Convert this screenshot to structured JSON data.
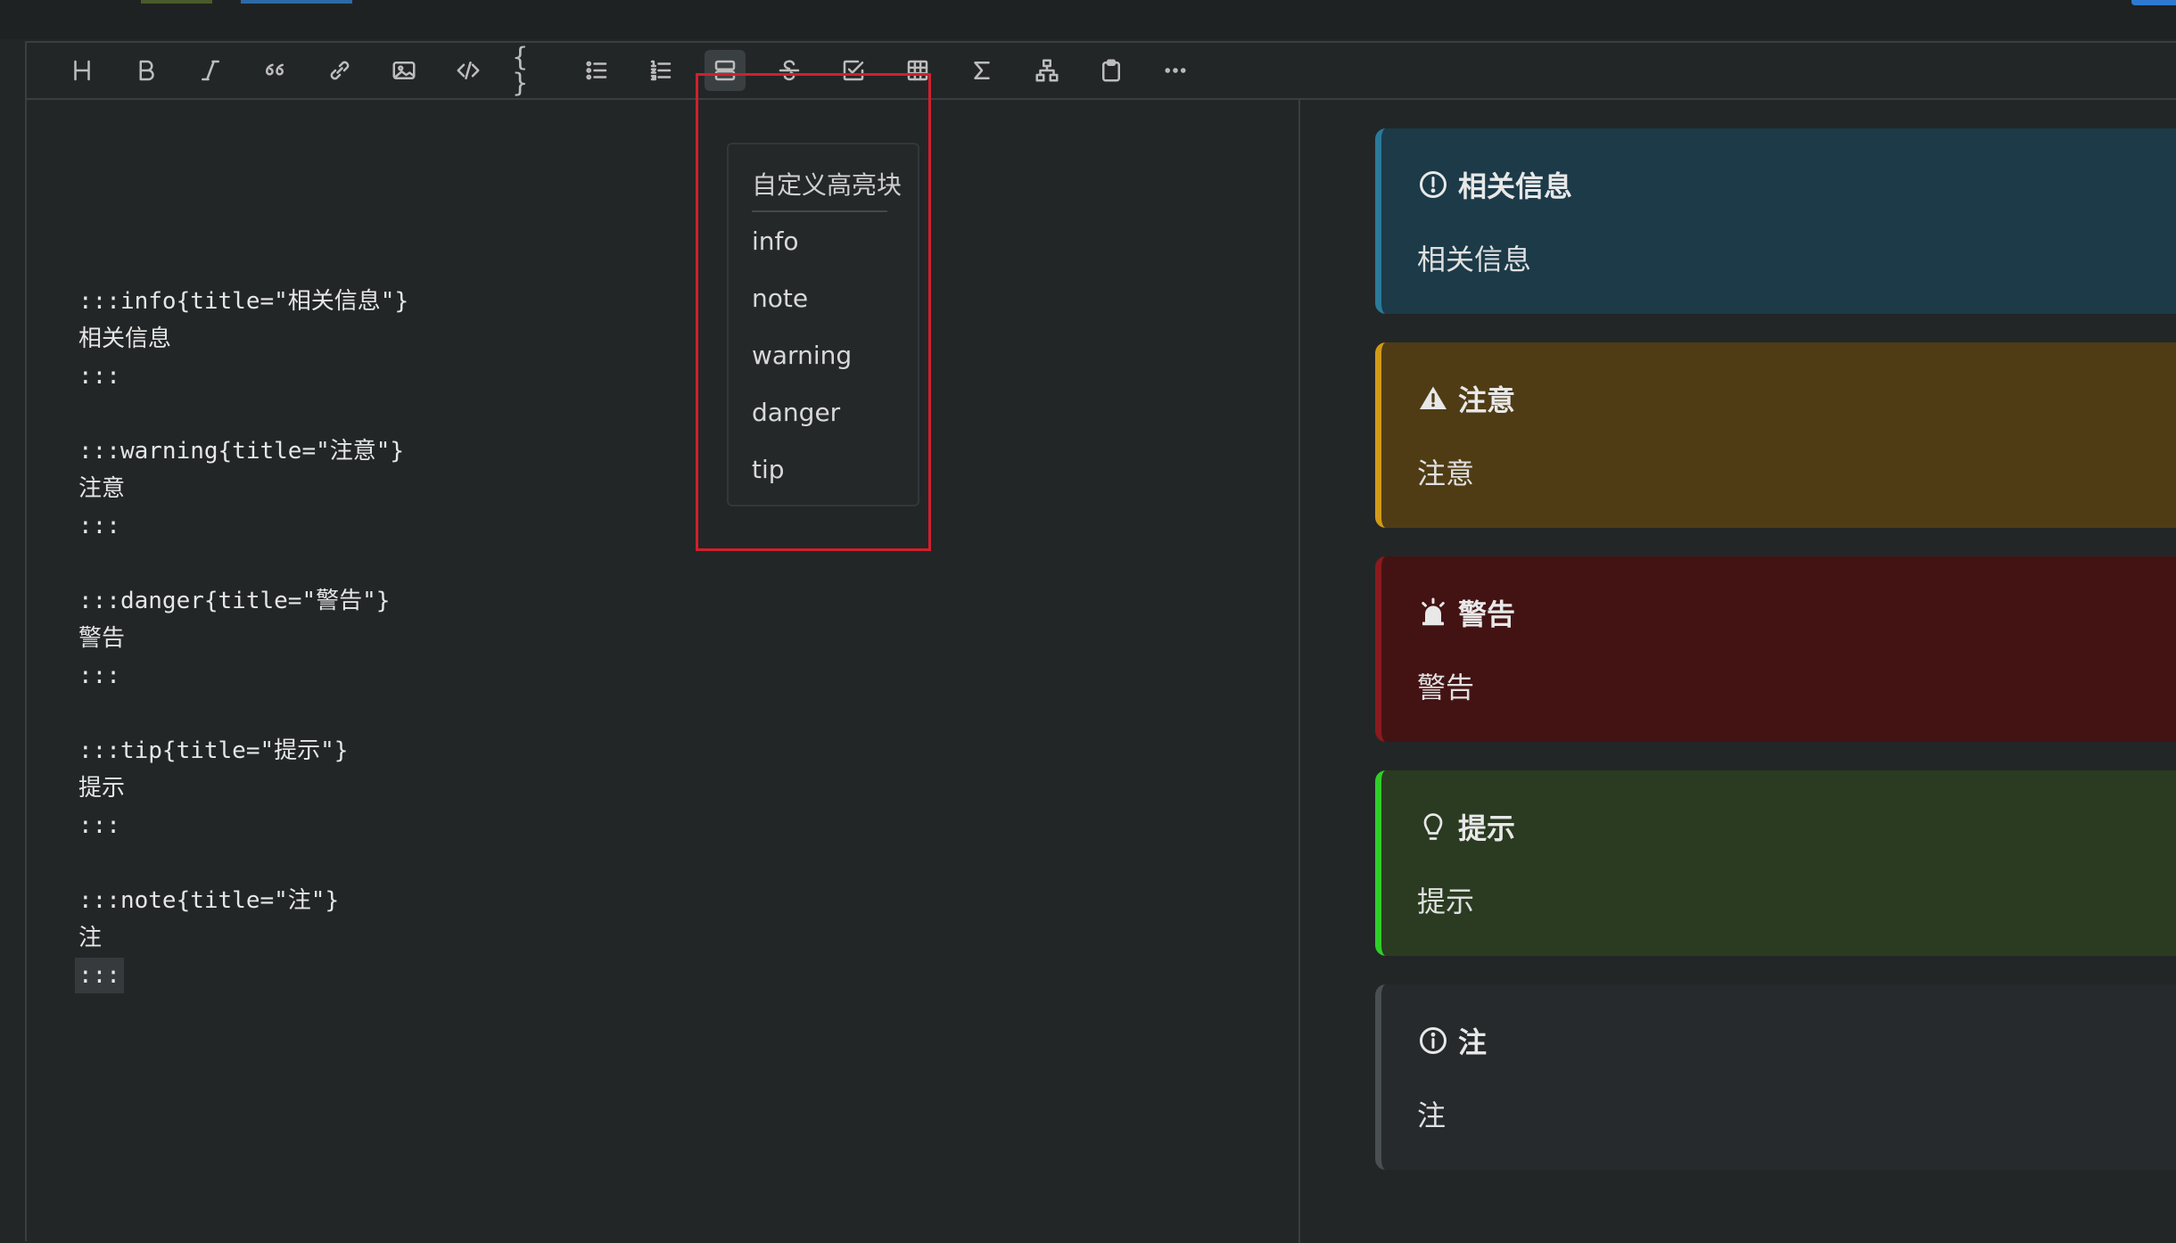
{
  "toolbar": {
    "buttons": [
      {
        "name": "heading-button",
        "icon": "heading-icon"
      },
      {
        "name": "bold-button",
        "icon": "bold-icon"
      },
      {
        "name": "italic-button",
        "icon": "italic-icon"
      },
      {
        "name": "quote-button",
        "icon": "quote-icon"
      },
      {
        "name": "link-button",
        "icon": "link-icon"
      },
      {
        "name": "image-button",
        "icon": "image-icon"
      },
      {
        "name": "inline-code-button",
        "icon": "code-icon"
      },
      {
        "name": "code-block-button",
        "icon": "braces-icon"
      },
      {
        "name": "bullet-list-button",
        "icon": "bullet-list-icon"
      },
      {
        "name": "ordered-list-button",
        "icon": "ordered-list-icon"
      },
      {
        "name": "container-button",
        "icon": "container-icon",
        "active": true
      },
      {
        "name": "strikethrough-button",
        "icon": "strikethrough-icon"
      },
      {
        "name": "task-list-button",
        "icon": "checkbox-icon"
      },
      {
        "name": "table-button",
        "icon": "table-icon"
      },
      {
        "name": "math-button",
        "icon": "sigma-icon"
      },
      {
        "name": "diagram-button",
        "icon": "diagram-icon"
      },
      {
        "name": "clipboard-button",
        "icon": "clipboard-icon"
      },
      {
        "name": "more-button",
        "icon": "more-icon"
      }
    ]
  },
  "dropdown": {
    "header": "自定义高亮块",
    "items": [
      "info",
      "note",
      "warning",
      "danger",
      "tip"
    ]
  },
  "source": {
    "lines": [
      ":::info{title=\"相关信息\"}",
      "相关信息",
      ":::",
      ":::warning{title=\"注意\"}",
      "注意",
      ":::",
      ":::danger{title=\"警告\"}",
      "警告",
      ":::",
      ":::tip{title=\"提示\"}",
      "提示",
      ":::",
      ":::note{title=\"注\"}",
      "注",
      ":::"
    ]
  },
  "preview": {
    "callouts": [
      {
        "type": "info",
        "title": "相关信息",
        "body": "相关信息",
        "icon": "exclamation-circle-icon",
        "bg": "#1c3a48",
        "border": "#2a7a9a"
      },
      {
        "type": "warning",
        "title": "注意",
        "body": "注意",
        "icon": "warning-triangle-icon",
        "bg": "#4f3c15",
        "border": "#d39a17"
      },
      {
        "type": "danger",
        "title": "警告",
        "body": "警告",
        "icon": "alarm-icon",
        "bg": "#431314",
        "border": "#8a1a1e"
      },
      {
        "type": "tip",
        "title": "提示",
        "body": "提示",
        "icon": "lightbulb-icon",
        "bg": "#2a3b21",
        "border": "#2fcf2a"
      },
      {
        "type": "note",
        "title": "注",
        "body": "注",
        "icon": "info-circle-icon",
        "bg": "#262a2c",
        "border": "#4a4f52"
      }
    ]
  },
  "colors": {
    "background": "#232627",
    "highlight_box": "#d0202c"
  }
}
